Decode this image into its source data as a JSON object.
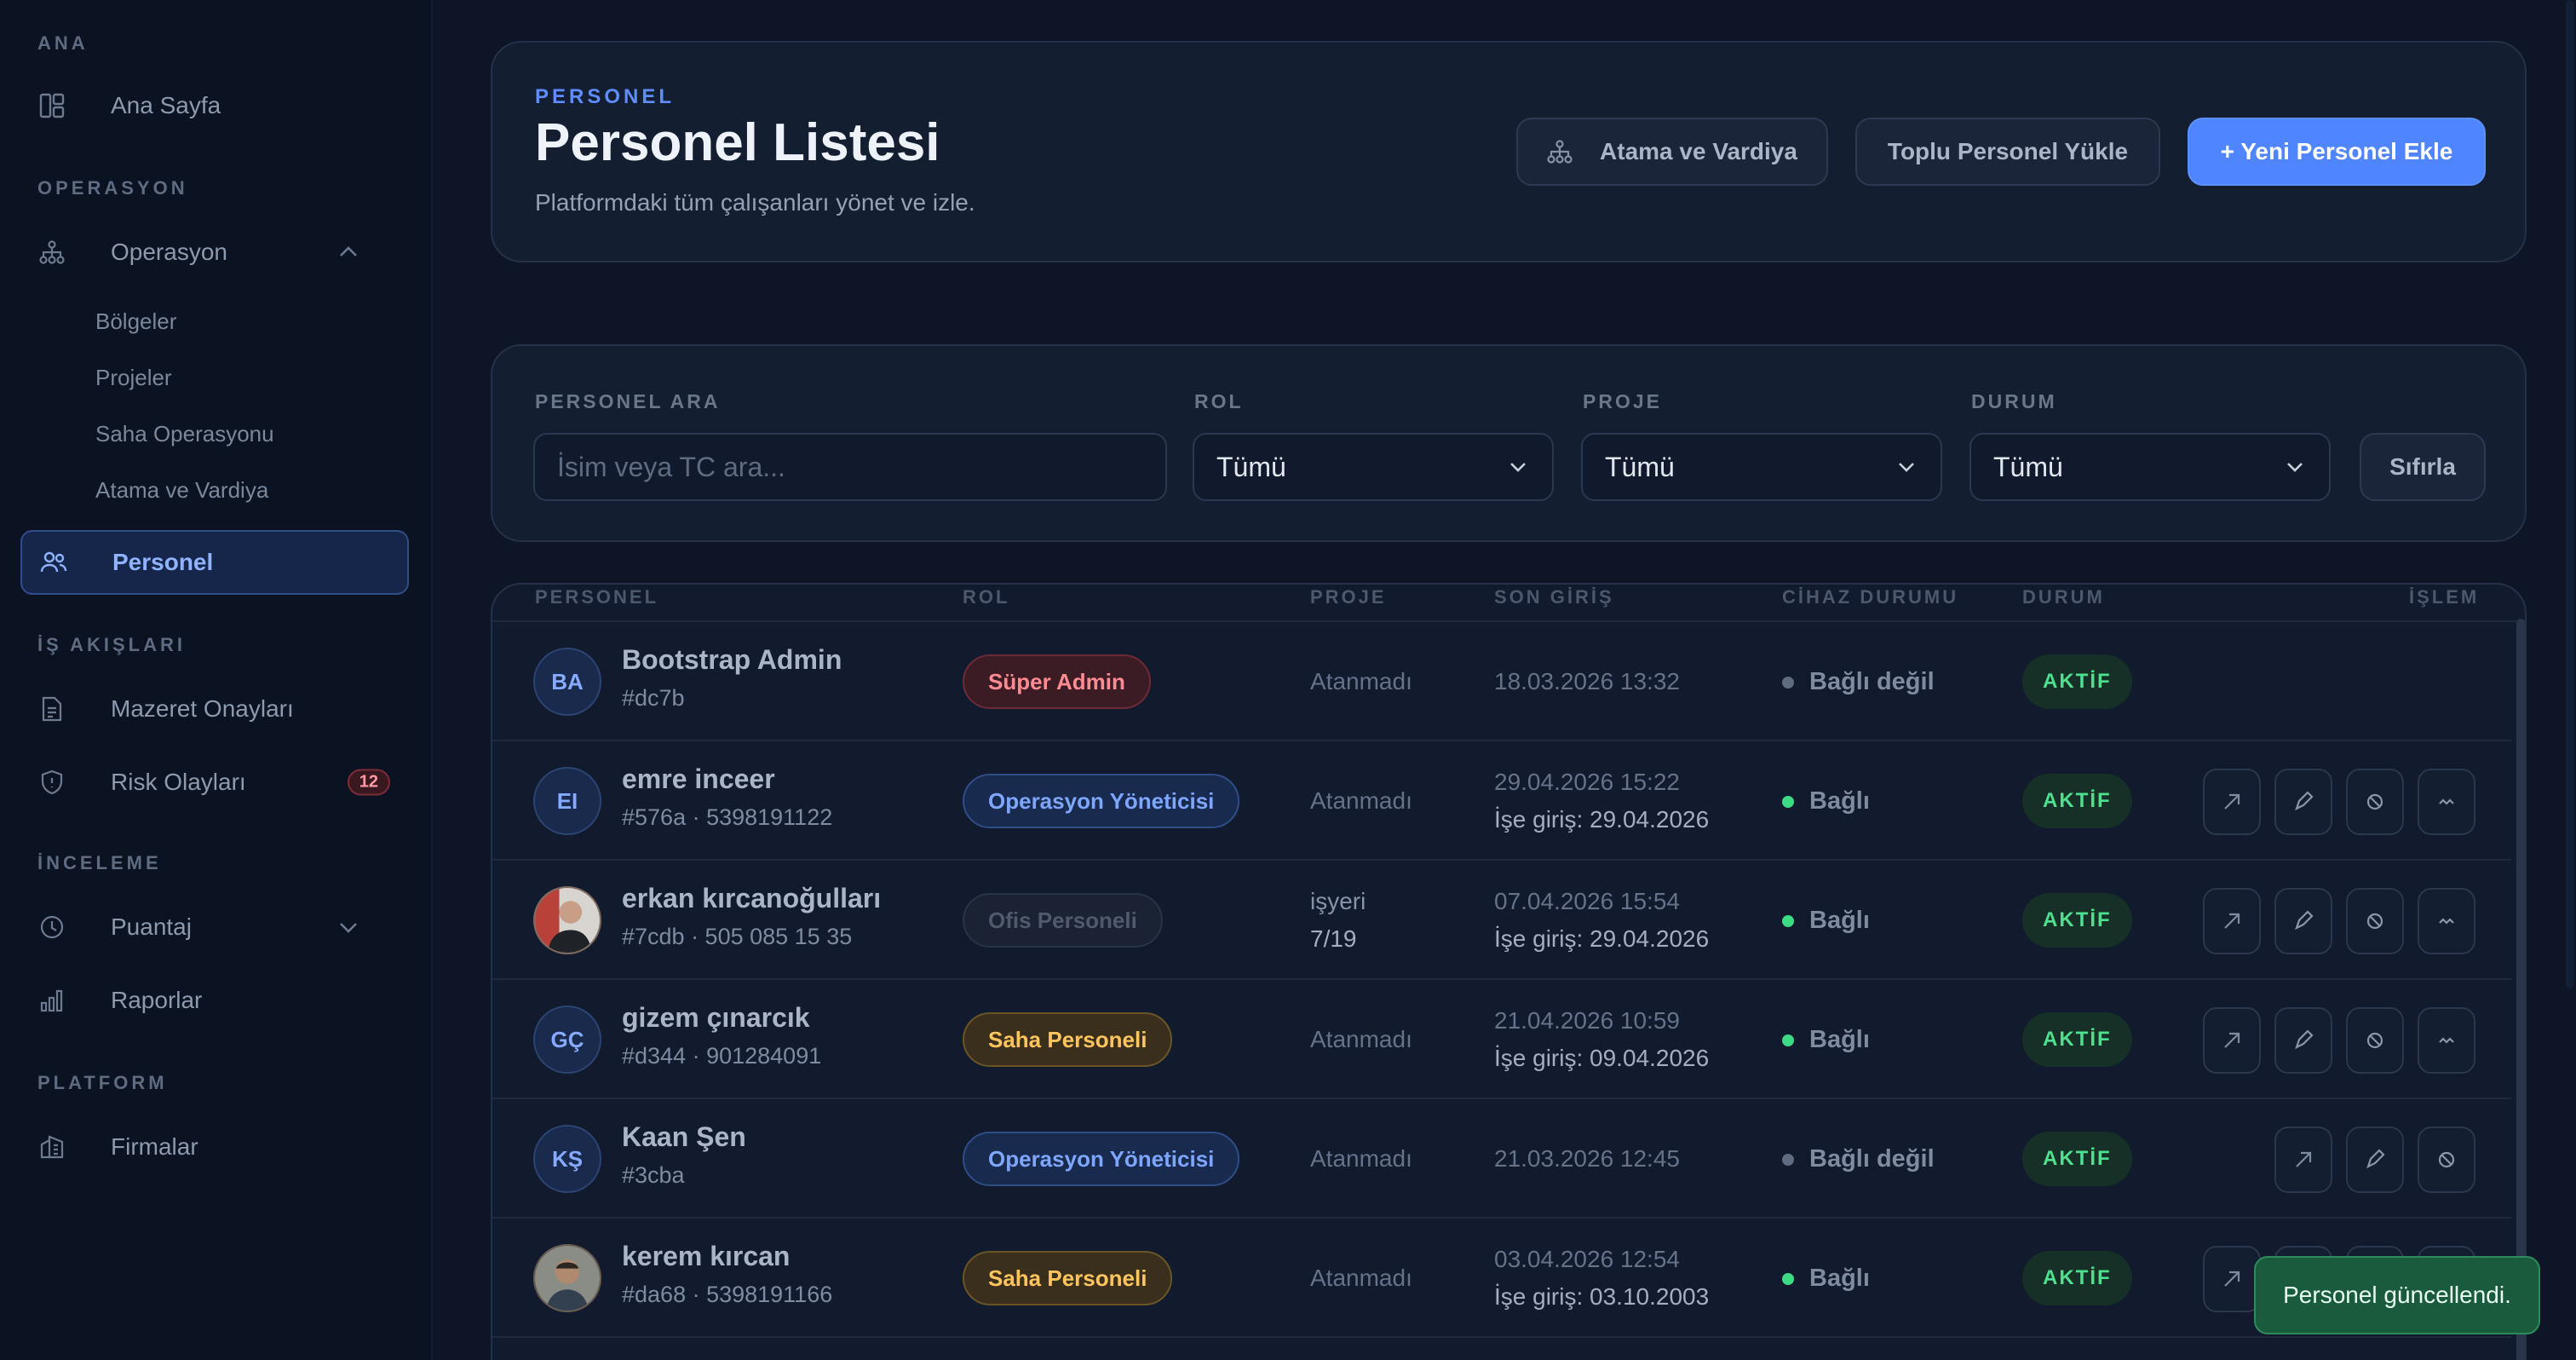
{
  "sidebar": {
    "sections": {
      "ana": "ANA",
      "operasyon": "OPERASYON",
      "is_akislari": "İŞ AKIŞLARI",
      "inceleme": "İNCELEME",
      "platform": "PLATFORM"
    },
    "items": {
      "ana_sayfa": "Ana Sayfa",
      "operasyon": "Operasyon",
      "bolgeler": "Bölgeler",
      "projeler": "Projeler",
      "saha_operasyonu": "Saha Operasyonu",
      "atama_vardiya": "Atama ve Vardiya",
      "personel": "Personel",
      "mazeret": "Mazeret Onayları",
      "risk": "Risk Olayları",
      "risk_badge": "12",
      "puantaj": "Puantaj",
      "raporlar": "Raporlar",
      "firmalar": "Firmalar"
    }
  },
  "header": {
    "eyebrow": "PERSONEL",
    "title": "Personel Listesi",
    "subtitle": "Platformdaki tüm çalışanları yönet ve izle.",
    "btn_assign": "Atama ve Vardiya",
    "btn_bulk": "Toplu Personel Yükle",
    "btn_new": "+ Yeni Personel Ekle"
  },
  "filters": {
    "search_label": "PERSONEL ARA",
    "search_placeholder": "İsim veya TC ara...",
    "role_label": "ROL",
    "role_value": "Tümü",
    "project_label": "PROJE",
    "project_value": "Tümü",
    "status_label": "DURUM",
    "status_value": "Tümü",
    "reset": "Sıfırla"
  },
  "table": {
    "columns": [
      "PERSONEL",
      "ROL",
      "PROJE",
      "SON GİRİŞ",
      "CİHAZ DURUMU",
      "DURUM",
      "İŞLEM"
    ],
    "rows": [
      {
        "initials": "BA",
        "name": "Bootstrap Admin",
        "meta": "#dc7b",
        "role": "Süper Admin",
        "project": "Atanmadı",
        "last": "18.03.2026 13:32",
        "hire": "",
        "device": "Bağlı değil",
        "status": "AKTİF"
      },
      {
        "initials": "EI",
        "name": "emre inceer",
        "meta": "#576a · 5398191122",
        "role": "Operasyon Yöneticisi",
        "project": "Atanmadı",
        "last": "29.04.2026 15:22",
        "hire": "İşe giriş: 29.04.2026",
        "device": "Bağlı",
        "status": "AKTİF"
      },
      {
        "initials": "",
        "name": "erkan kırcanoğulları",
        "meta": "#7cdb · 505 085 15 35",
        "role": "Ofis Personeli",
        "project": "işyeri",
        "project2": "7/19",
        "last": "07.04.2026 15:54",
        "hire": "İşe giriş: 29.04.2026",
        "device": "Bağlı",
        "status": "AKTİF"
      },
      {
        "initials": "GÇ",
        "name": "gizem çınarcık",
        "meta": "#d344 · 901284091",
        "role": "Saha Personeli",
        "project": "Atanmadı",
        "last": "21.04.2026 10:59",
        "hire": "İşe giriş: 09.04.2026",
        "device": "Bağlı",
        "status": "AKTİF"
      },
      {
        "initials": "KŞ",
        "name": "Kaan Şen",
        "meta": "#3cba",
        "role": "Operasyon Yöneticisi",
        "project": "Atanmadı",
        "last": "21.03.2026 12:45",
        "hire": "",
        "device": "Bağlı değil",
        "status": "AKTİF"
      },
      {
        "initials": "",
        "name": "kerem kırcan",
        "meta": "#da68 · 5398191166",
        "role": "Saha Personeli",
        "project": "Atanmadı",
        "last": "03.04.2026 12:54",
        "hire": "İşe giriş: 03.10.2003",
        "device": "Bağlı",
        "status": "AKTİF"
      }
    ]
  },
  "toast": "Personel güncellendi.",
  "colors": {
    "accent": "#4f86ff",
    "active_status": "#4ee08f",
    "connected_dot": "#3ddc84",
    "disconnected_dot": "#5f6b80"
  }
}
